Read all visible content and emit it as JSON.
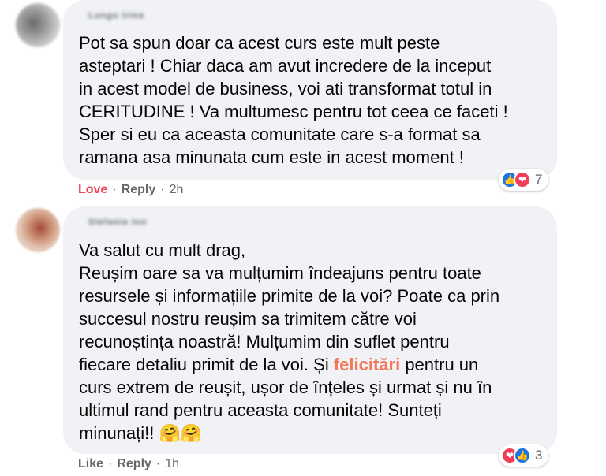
{
  "comments": [
    {
      "author": "Lungu Irina",
      "text": "Pot sa spun doar ca acest curs este mult peste\nasteptari ! Chiar daca am avut incredere de la inceput\nin acest model de business, voi ati transformat totul in\nCERITUDINE ! Va multumesc pentru tot ceea ce faceti !\nSper si eu ca aceasta comunitate care s-a format sa\nramana asa minunata cum este in acest moment !",
      "reaction_count": "7",
      "reaction_icons": [
        "like-icon",
        "love-icon"
      ],
      "actions": {
        "reaction": "Love",
        "reply": "Reply",
        "time": "2h"
      }
    },
    {
      "author": "Stefania Ion",
      "text_before": "Va salut cu mult drag,\nReușim oare sa va mulțumim îndeajuns pentru toate\nresursele și informațiile primite de la voi? Poate ca prin\nsuccesul nostru reușim sa trimitem către voi\nrecunoștința noastră! Mulțumim din suflet pentru\nfiecare detaliu primit de la voi. Și ",
      "highlight": "felicitări",
      "text_after": " pentru un\ncurs extrem de reușit, ușor de înțeles și urmat și nu în\nultimul rand pentru aceasta comunitate! Sunteți\nminunați!! ",
      "emoji": "🤗🤗",
      "reaction_count": "3",
      "reaction_icons": [
        "love-icon",
        "like-icon"
      ],
      "actions": {
        "reaction": "Like",
        "reply": "Reply",
        "time": "1h"
      }
    }
  ],
  "colors": {
    "bubble": "#f0f2f5",
    "love": "#f33e58",
    "like": "#1b74e4",
    "highlight": "#f5775a",
    "meta": "#65676b"
  }
}
